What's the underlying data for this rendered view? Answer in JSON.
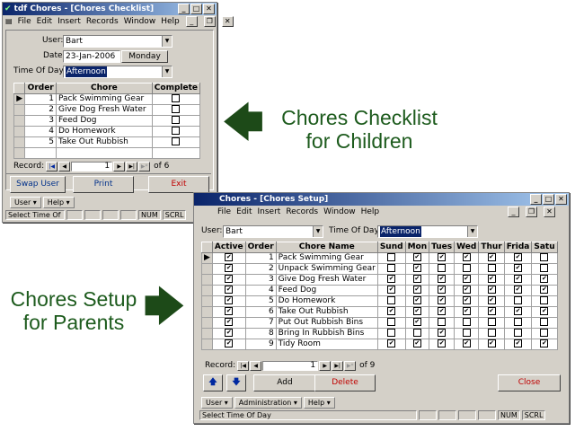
{
  "checklist": {
    "title": "tdf Chores - [Chores Checklist]",
    "menu": [
      "File",
      "Edit",
      "Insert",
      "Records",
      "Window",
      "Help"
    ],
    "user_label": "User:",
    "user_value": "Bart",
    "date_label": "Date:",
    "date_value": "23-Jan-2006",
    "day_value": "Monday",
    "time_label": "Time Of Day:",
    "time_value": "Afternoon",
    "columns": [
      "Order",
      "Chore",
      "Complete"
    ],
    "rows": [
      {
        "order": "1",
        "chore": "Pack Swimming Gear",
        "complete": false
      },
      {
        "order": "2",
        "chore": "Give Dog Fresh Water",
        "complete": false
      },
      {
        "order": "3",
        "chore": "Feed Dog",
        "complete": false
      },
      {
        "order": "4",
        "chore": "Do Homework",
        "complete": false
      },
      {
        "order": "5",
        "chore": "Take Out Rubbish",
        "complete": false
      }
    ],
    "record_label": "Record:",
    "record_current": "1",
    "record_of": "of 6",
    "buttons": {
      "swap": "Swap User",
      "print": "Print",
      "exit": "Exit"
    },
    "toolbar": [
      "User ▾",
      "Help ▾"
    ],
    "status_text": "Select Time Of",
    "status_num": "NUM",
    "status_scrl": "SCRL"
  },
  "setup": {
    "title": "Chores - [Chores Setup]",
    "menu": [
      "File",
      "Edit",
      "Insert",
      "Records",
      "Window",
      "Help"
    ],
    "user_label": "User:",
    "user_value": "Bart",
    "time_label": "Time Of Day:",
    "time_value": "Afternoon",
    "columns": [
      "Active",
      "Order",
      "Chore Name",
      "Sund",
      "Mon",
      "Tues",
      "Wed",
      "Thur",
      "Frida",
      "Satu"
    ],
    "rows": [
      {
        "active": true,
        "order": "1",
        "name": "Pack Swimming Gear",
        "days": [
          false,
          true,
          true,
          true,
          true,
          true,
          false
        ]
      },
      {
        "active": true,
        "order": "2",
        "name": "Unpack Swimming Gear",
        "days": [
          false,
          true,
          false,
          false,
          false,
          true,
          false
        ]
      },
      {
        "active": true,
        "order": "3",
        "name": "Give Dog Fresh Water",
        "days": [
          true,
          true,
          true,
          true,
          true,
          true,
          true
        ]
      },
      {
        "active": true,
        "order": "4",
        "name": "Feed Dog",
        "days": [
          true,
          true,
          true,
          true,
          true,
          true,
          true
        ]
      },
      {
        "active": true,
        "order": "5",
        "name": "Do Homework",
        "days": [
          false,
          true,
          true,
          true,
          true,
          false,
          false
        ]
      },
      {
        "active": true,
        "order": "6",
        "name": "Take Out Rubbish",
        "days": [
          true,
          true,
          true,
          true,
          true,
          true,
          true
        ]
      },
      {
        "active": true,
        "order": "7",
        "name": "Put Out Rubbish Bins",
        "days": [
          false,
          true,
          false,
          false,
          false,
          false,
          false
        ]
      },
      {
        "active": true,
        "order": "8",
        "name": "Bring In Rubbish Bins",
        "days": [
          false,
          false,
          true,
          false,
          false,
          false,
          false
        ]
      },
      {
        "active": true,
        "order": "9",
        "name": "Tidy Room",
        "days": [
          true,
          true,
          true,
          true,
          true,
          true,
          true
        ]
      }
    ],
    "record_label": "Record:",
    "record_current": "1",
    "record_of": "of 9",
    "buttons": {
      "add": "Add",
      "delete": "Delete",
      "close": "Close"
    },
    "toolbar": [
      "User ▾",
      "Administration ▾",
      "Help ▾"
    ],
    "status_text": "Select Time Of Day",
    "status_num": "NUM",
    "status_scrl": "SCRL"
  },
  "captions": {
    "children_line1": "Chores Checklist",
    "children_line2": "for Children",
    "parents_line1": "Chores Setup",
    "parents_line2": "for Parents"
  },
  "colors": {
    "caption": "#1d5b1d",
    "titlebar": "#0a246a",
    "delete_text": "#c00000",
    "close_text": "#c00000",
    "exit_text": "#c00000",
    "swap_text": "#00308a",
    "nav_arrows": "#0028a0"
  }
}
